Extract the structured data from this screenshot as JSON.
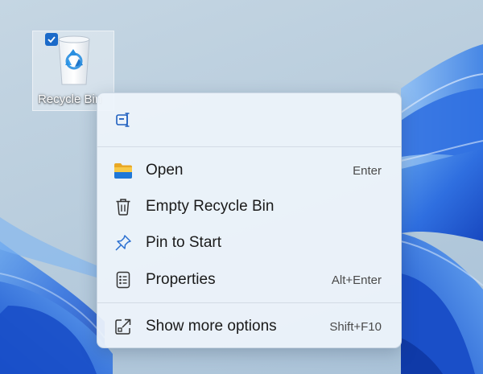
{
  "desktop": {
    "icon": {
      "label": "Recycle Bin",
      "selected": true
    }
  },
  "context_menu": {
    "top_actions": [
      {
        "icon": "rename-icon"
      }
    ],
    "items": [
      {
        "label": "Open",
        "shortcut": "Enter",
        "icon": "folder-icon"
      },
      {
        "label": "Empty Recycle Bin",
        "shortcut": "",
        "icon": "trash-icon"
      },
      {
        "label": "Pin to Start",
        "shortcut": "",
        "icon": "pin-icon"
      },
      {
        "label": "Properties",
        "shortcut": "Alt+Enter",
        "icon": "properties-icon"
      }
    ],
    "more": {
      "label": "Show more options",
      "shortcut": "Shift+F10",
      "icon": "show-more-icon"
    }
  },
  "colors": {
    "accent": "#1b6ac9",
    "menu_bg": "#eef4fb",
    "wallpaper_blue": "#1d5fd8"
  }
}
